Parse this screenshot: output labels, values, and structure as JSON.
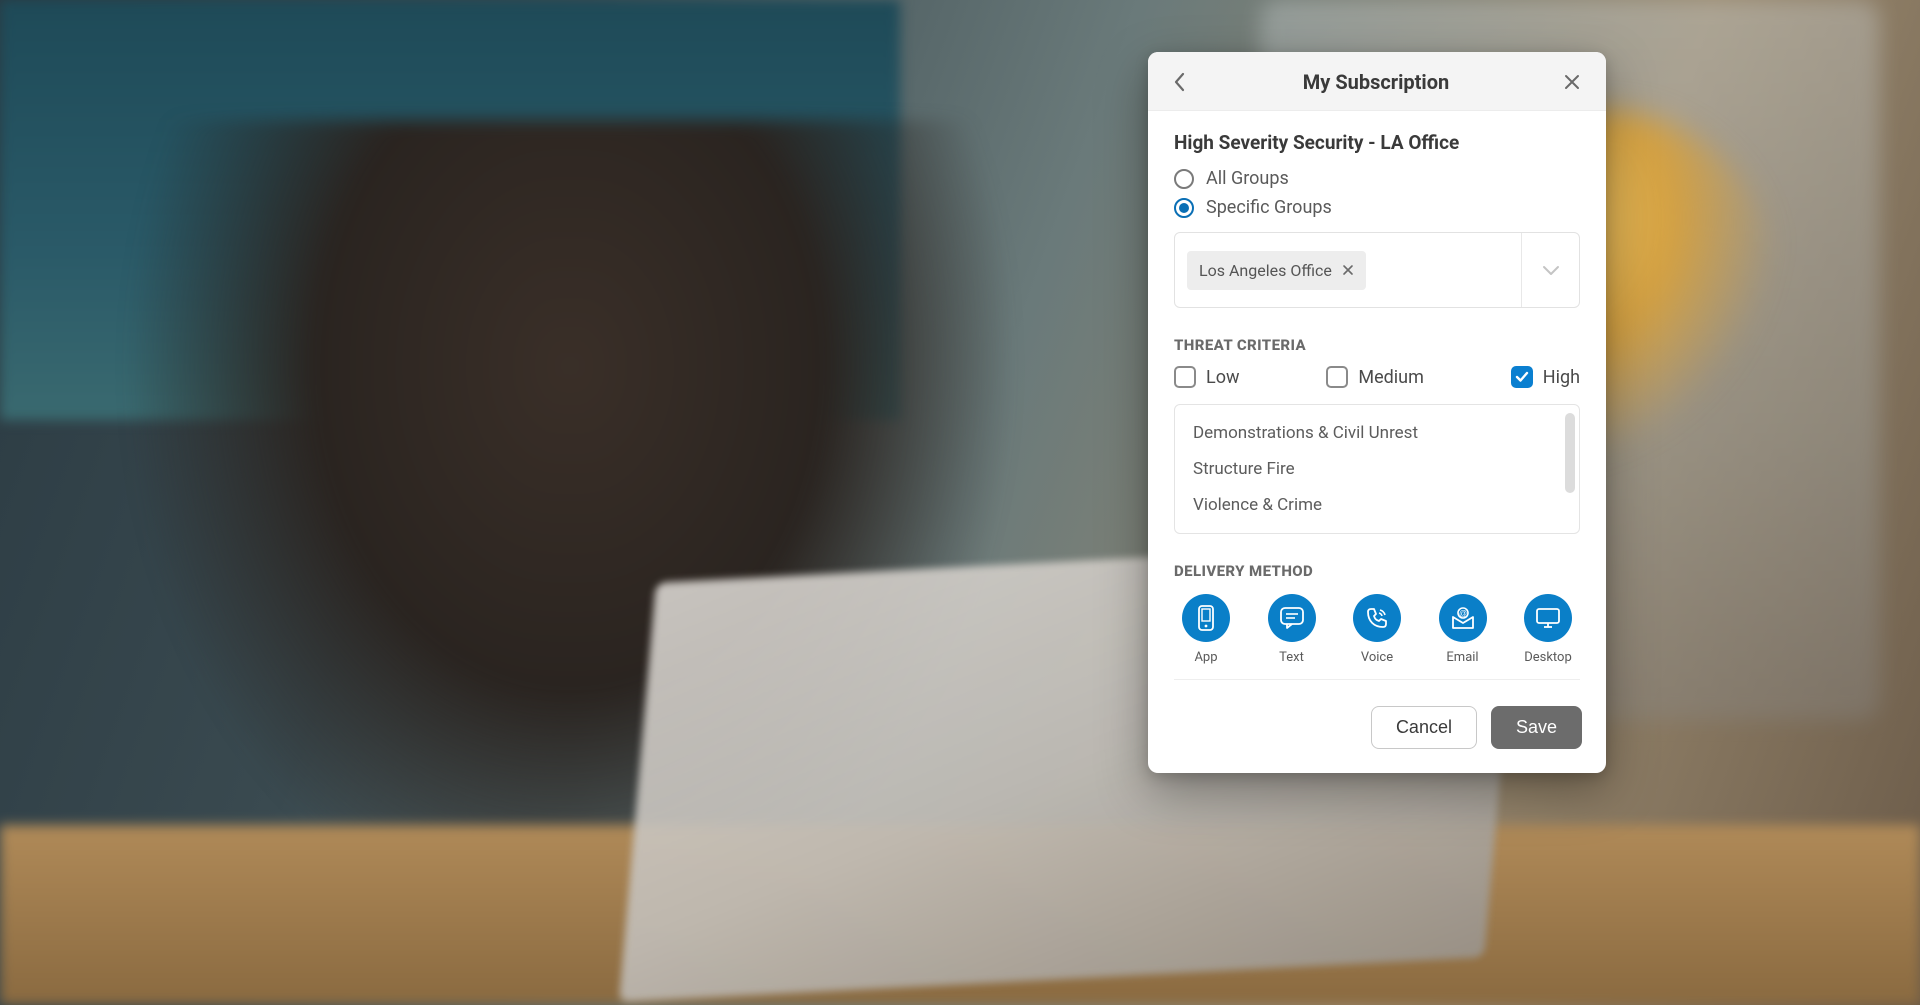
{
  "dialog": {
    "title": "My Subscription",
    "subscription_name": "High Severity Security - LA Office",
    "groups": {
      "option_all_label": "All Groups",
      "option_specific_label": "Specific Groups",
      "selected_option": "specific",
      "chips": [
        {
          "label": "Los Angeles Office"
        }
      ]
    },
    "threat": {
      "section_label": "THREAT CRITERIA",
      "levels": {
        "low": {
          "label": "Low",
          "checked": false
        },
        "medium": {
          "label": "Medium",
          "checked": false
        },
        "high": {
          "label": "High",
          "checked": true
        }
      },
      "categories": [
        "Demonstrations & Civil Unrest",
        "Structure Fire",
        "Violence & Crime"
      ]
    },
    "delivery": {
      "section_label": "DELIVERY METHOD",
      "methods": [
        {
          "icon": "app",
          "label": "App"
        },
        {
          "icon": "text",
          "label": "Text"
        },
        {
          "icon": "voice",
          "label": "Voice"
        },
        {
          "icon": "email",
          "label": "Email"
        },
        {
          "icon": "desktop",
          "label": "Desktop"
        }
      ]
    },
    "buttons": {
      "cancel": "Cancel",
      "save": "Save"
    }
  },
  "colors": {
    "accent": "#0a7fc8"
  }
}
